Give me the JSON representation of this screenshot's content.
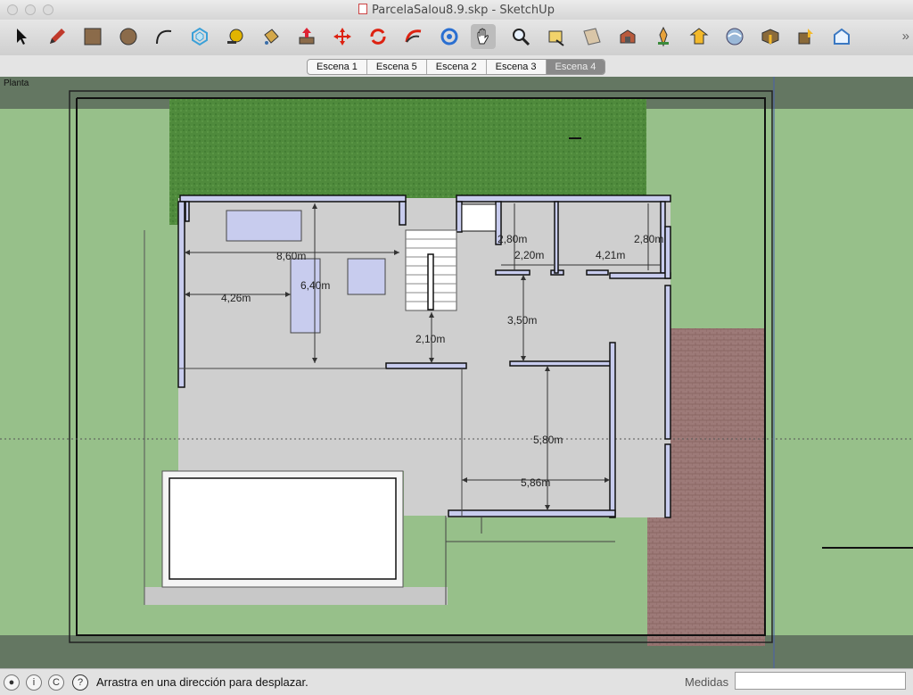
{
  "window": {
    "title": "ParcelaSalou8.9.skp - SketchUp"
  },
  "toolbar": {
    "tools": [
      {
        "name": "select-tool-icon"
      },
      {
        "name": "pencil-tool-icon"
      },
      {
        "name": "rectangle-tool-icon"
      },
      {
        "name": "circle-tool-icon"
      },
      {
        "name": "arc-tool-icon"
      },
      {
        "name": "offset-tool-icon"
      },
      {
        "name": "tape-measure-tool-icon"
      },
      {
        "name": "paint-bucket-tool-icon"
      },
      {
        "name": "push-pull-tool-icon"
      },
      {
        "name": "move-tool-icon"
      },
      {
        "name": "rotate-tool-icon"
      },
      {
        "name": "follow-me-tool-icon"
      },
      {
        "name": "orbit-tool-icon"
      },
      {
        "name": "pan-tool-icon",
        "active": true
      },
      {
        "name": "zoom-tool-icon"
      },
      {
        "name": "zoom-extents-tool-icon"
      },
      {
        "name": "section-plane-tool-icon"
      },
      {
        "name": "components-tool-icon"
      },
      {
        "name": "add-location-tool-icon"
      },
      {
        "name": "get-models-tool-icon"
      },
      {
        "name": "share-model-tool-icon"
      },
      {
        "name": "extension-warehouse-tool-icon"
      },
      {
        "name": "share-component-tool-icon"
      },
      {
        "name": "layout-tool-icon"
      }
    ],
    "more_glyph": "»"
  },
  "scenes": {
    "tabs": [
      "Escena 1",
      "Escena 5",
      "Escena 2",
      "Escena 3",
      "Escena 4"
    ],
    "selected": "Escena 4"
  },
  "viewport": {
    "scene_label": "Planta",
    "dimensions": [
      "8,60m",
      "6,40m",
      "4,26m",
      "2,10m",
      "2,80m",
      "2,20m",
      "2,80m",
      "4,21m",
      "3,50m",
      "5,80m",
      "5,86m"
    ]
  },
  "statusbar": {
    "message": "Arrastra en una dirección para desplazar.",
    "measurements_label": "Medidas",
    "measurements_value": "",
    "help_glyph": "?"
  },
  "colors": {
    "grass": "#97c08a",
    "lawn_texture": "#4f8a3c",
    "floor": "#cfcfcf",
    "wall": "#c8ccee",
    "paving": "#9d7a78"
  }
}
